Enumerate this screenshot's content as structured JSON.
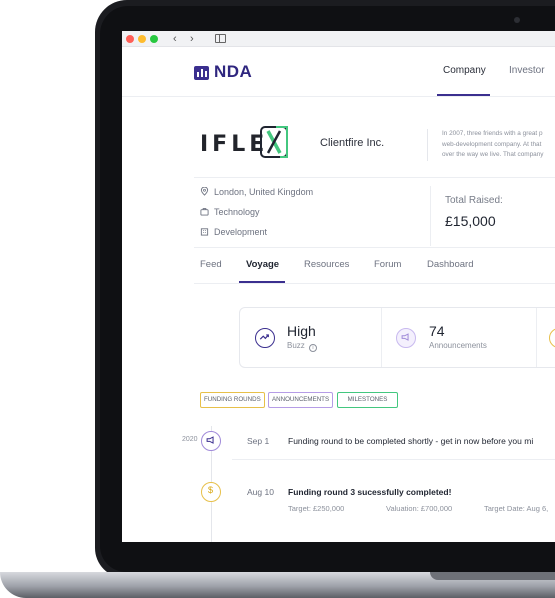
{
  "browser": {
    "back_icon": "chevron-left-icon",
    "forward_icon": "chevron-right-icon",
    "sidebar_icon": "sidebar-icon"
  },
  "header": {
    "logo_text": "NDA",
    "tabs": [
      {
        "label": "Company"
      },
      {
        "label": "Investor"
      }
    ]
  },
  "company": {
    "brand_mark_text": "IFLE",
    "name": "Clientfire Inc.",
    "description_lines": [
      "In 2007, three friends with a great p",
      "web-development company. At that",
      "over the way we live. That company"
    ],
    "location": "London, United Kingdom",
    "sector": "Technology",
    "stage": "Development",
    "total_raised_label": "Total Raised:",
    "total_raised_value": "£15,000"
  },
  "subnav": {
    "tabs": [
      {
        "label": "Feed"
      },
      {
        "label": "Voyage"
      },
      {
        "label": "Resources"
      },
      {
        "label": "Forum"
      },
      {
        "label": "Dashboard"
      }
    ]
  },
  "stats": {
    "buzz_value": "High",
    "buzz_label": "Buzz",
    "announcements_value": "74",
    "announcements_label": "Announcements"
  },
  "filters": [
    "FUNDING ROUNDS",
    "ANNOUNCEMENTS",
    "MILESTONES"
  ],
  "timeline": {
    "year": "2020",
    "items": [
      {
        "date": "Sep 1",
        "text": "Funding round to be completed shortly - get in now before you mi"
      },
      {
        "date": "Aug 10",
        "text": "Funding round 3 sucessfully completed!",
        "target": "Target: £250,000",
        "valuation": "Valuation: £700,000",
        "target_date": "Target Date: Aug 6,"
      }
    ]
  },
  "colors": {
    "brand": "#3b2f8f",
    "green": "#43c77f",
    "gold": "#e7c04a",
    "purple": "#b59ce6"
  }
}
